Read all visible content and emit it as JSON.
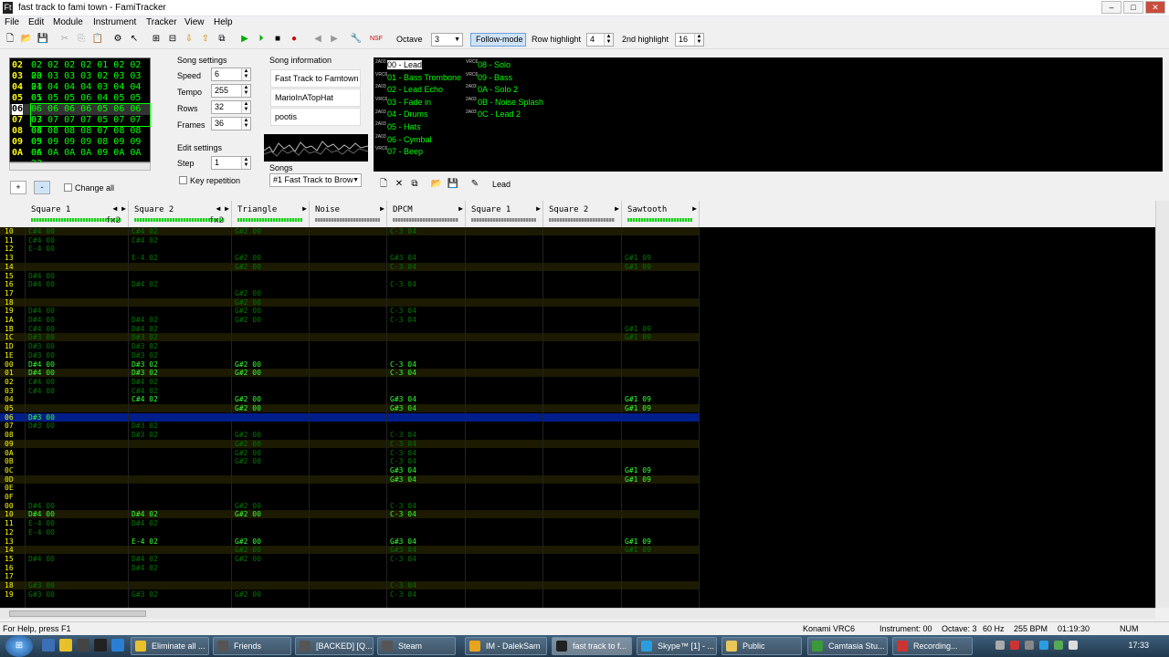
{
  "window": {
    "title": "fast track to fami town - FamiTracker",
    "icon": "Ft"
  },
  "menu": [
    "File",
    "Edit",
    "Module",
    "Instrument",
    "Tracker",
    "View",
    "Help"
  ],
  "toolbar": {
    "octave_label": "Octave",
    "octave_value": "3",
    "follow_mode": "Follow-mode",
    "row_highlight_label": "Row highlight",
    "row_highlight_value": "4",
    "second_highlight_label": "2nd highlight",
    "second_highlight_value": "16",
    "nsf": "NSF"
  },
  "frames": {
    "rows": [
      {
        "n": "02",
        "c": "02 02 02 02 01 02 02 20"
      },
      {
        "n": "03",
        "c": "03 03 03 03 02 03 03 21"
      },
      {
        "n": "04",
        "c": "04 04 04 04 03 04 04 01"
      },
      {
        "n": "05",
        "c": "05 05 05 06 04 05 05 02"
      },
      {
        "n": "06",
        "c": "06 06 06 06 05 06 06 03",
        "current": true
      },
      {
        "n": "07",
        "c": "07 07 07 07 05 07 07 04"
      },
      {
        "n": "08",
        "c": "08 08 08 08 07 08 08 05"
      },
      {
        "n": "09",
        "c": "09 09 09 09 08 09 09 06"
      },
      {
        "n": "0A",
        "c": "0A 0A 0A 0A 09 0A 0A 22"
      }
    ]
  },
  "song_settings": {
    "title": "Song settings",
    "speed_label": "Speed",
    "speed": "6",
    "tempo_label": "Tempo",
    "tempo": "255",
    "rows_label": "Rows",
    "rows": "32",
    "frames_label": "Frames",
    "frames": "36"
  },
  "edit_settings": {
    "title": "Edit settings",
    "step_label": "Step",
    "step": "1",
    "key_repetition": "Key repetition"
  },
  "song_info": {
    "title": "Song information",
    "name": "Fast Track to Famtown",
    "artist": "MarioInATopHat",
    "copyright": "pootis"
  },
  "songs": {
    "label": "Songs",
    "selected": "#1 Fast Track to Brow"
  },
  "frame_buttons": {
    "add": "+",
    "remove": "-",
    "change_all": "Change all"
  },
  "instruments": [
    {
      "id": "00 - Lead",
      "tag": "2A03",
      "selected": true
    },
    {
      "id": "01 - Bass Trombone",
      "tag": "VRC6"
    },
    {
      "id": "02 - Lead Echo",
      "tag": "2A03"
    },
    {
      "id": "03 - Fade in",
      "tag": "VRC6"
    },
    {
      "id": "04 - Drums",
      "tag": "2A03"
    },
    {
      "id": "05 - Hats",
      "tag": "2A03"
    },
    {
      "id": "06 - Cymbal",
      "tag": "2A03"
    },
    {
      "id": "07 - Beep",
      "tag": "VRC6"
    },
    {
      "id": "08 - Solo",
      "tag": "VRC6"
    },
    {
      "id": "09 - Bass",
      "tag": "VRC6"
    },
    {
      "id": "0A - Solo 2",
      "tag": "2A03"
    },
    {
      "id": "0B - Noise Splash",
      "tag": "2A03"
    },
    {
      "id": "0C - Lead 2",
      "tag": "2A03"
    }
  ],
  "instrument_name": "Lead",
  "channels": [
    {
      "name": "Square 1",
      "fx": "fx2",
      "on": true
    },
    {
      "name": "Square 2",
      "fx": "fx2",
      "on": true
    },
    {
      "name": "Triangle",
      "fx": "",
      "on": true
    },
    {
      "name": "Noise",
      "fx": "",
      "on": false
    },
    {
      "name": "DPCM",
      "fx": "",
      "on": false
    },
    {
      "name": "Square 1",
      "fx": "",
      "on": false
    },
    {
      "name": "Square 2",
      "fx": "",
      "on": false
    },
    {
      "name": "Sawtooth",
      "fx": "",
      "on": true
    }
  ],
  "pattern_rows": [
    {
      "n": "10",
      "c": [
        "C#4 00",
        "C#4 02",
        "G#2 00",
        "",
        "C-3 04",
        "",
        "",
        ""
      ]
    },
    {
      "n": "11",
      "c": [
        "C#4 00",
        "C#4 02",
        "",
        "",
        "",
        "",
        "",
        ""
      ]
    },
    {
      "n": "12",
      "c": [
        "E-4 00",
        "",
        "",
        "",
        "",
        "",
        "",
        ""
      ]
    },
    {
      "n": "13",
      "c": [
        "",
        "E-4 02",
        "G#2 00",
        "",
        "G#3 04",
        "",
        "",
        "G#1 09"
      ]
    },
    {
      "n": "14",
      "c": [
        "",
        "",
        "G#2 00",
        "",
        "C-3 04",
        "",
        "",
        "G#1 09"
      ]
    },
    {
      "n": "15",
      "c": [
        "D#4 00",
        "",
        "",
        "",
        "",
        "",
        "",
        ""
      ]
    },
    {
      "n": "16",
      "c": [
        "D#4 00",
        "D#4 02",
        "",
        "",
        "C-3 04",
        "",
        "",
        ""
      ]
    },
    {
      "n": "17",
      "c": [
        "",
        "",
        "G#2 00",
        "",
        "",
        "",
        "",
        ""
      ]
    },
    {
      "n": "18",
      "c": [
        "",
        "",
        "G#2 00",
        "",
        "",
        "",
        "",
        ""
      ]
    },
    {
      "n": "19",
      "c": [
        "D#4 00",
        "",
        "G#2 00",
        "",
        "C-3 04",
        "",
        "",
        ""
      ]
    },
    {
      "n": "1A",
      "c": [
        "D#4 00",
        "D#4 02",
        "G#2 00",
        "",
        "C-3 04",
        "",
        "",
        ""
      ]
    },
    {
      "n": "1B",
      "c": [
        "C#4 00",
        "D#4 02",
        "",
        "",
        "",
        "",
        "",
        "G#1 09"
      ]
    },
    {
      "n": "1C",
      "c": [
        "D#3 00",
        "D#3 02",
        "",
        "",
        "",
        "",
        "",
        "G#1 09"
      ]
    },
    {
      "n": "1D",
      "c": [
        "D#3 00",
        "D#3 02",
        "",
        "",
        "",
        "",
        "",
        ""
      ]
    },
    {
      "n": "1E",
      "c": [
        "D#3 00",
        "D#3 02",
        "",
        "",
        "",
        "",
        "",
        ""
      ]
    },
    {
      "n": "00",
      "c": [
        "D#4 00",
        "D#3 02",
        "G#2 00",
        "",
        "C-3 04",
        "",
        "",
        ""
      ],
      "b": true
    },
    {
      "n": "01",
      "c": [
        "D#4 00",
        "D#3 02",
        "G#2 00",
        "",
        "C-3 04",
        "",
        "",
        ""
      ],
      "b": true
    },
    {
      "n": "02",
      "c": [
        "C#4 00",
        "D#4 02",
        "",
        "",
        "",
        "",
        "",
        ""
      ]
    },
    {
      "n": "03",
      "c": [
        "C#4 00",
        "C#4 02",
        "",
        "",
        "",
        "",
        "",
        ""
      ]
    },
    {
      "n": "04",
      "c": [
        "",
        "C#4 02",
        "G#2 00",
        "",
        "G#3 04",
        "",
        "",
        "G#1 09"
      ],
      "b": true
    },
    {
      "n": "05",
      "c": [
        "",
        "",
        "G#2 00",
        "",
        "G#3 04",
        "",
        "",
        "G#1 09"
      ],
      "b": true
    },
    {
      "n": "06",
      "c": [
        "D#3 00",
        "",
        "",
        "",
        "",
        "",
        "",
        ""
      ],
      "cur": true
    },
    {
      "n": "07",
      "c": [
        "D#3 00",
        "D#3 02",
        "",
        "",
        "",
        "",
        "",
        ""
      ]
    },
    {
      "n": "08",
      "c": [
        "",
        "D#3 02",
        "G#2 00",
        "",
        "C-3 04",
        "",
        "",
        ""
      ]
    },
    {
      "n": "09",
      "c": [
        "",
        "",
        "G#2 00",
        "",
        "C-3 04",
        "",
        "",
        ""
      ]
    },
    {
      "n": "0A",
      "c": [
        "",
        "",
        "G#2 00",
        "",
        "C-3 04",
        "",
        "",
        ""
      ]
    },
    {
      "n": "0B",
      "c": [
        "",
        "",
        "G#2 00",
        "",
        "C-3 04",
        "",
        "",
        ""
      ]
    },
    {
      "n": "0C",
      "c": [
        "",
        "",
        "",
        "",
        "G#3 04",
        "",
        "",
        "G#1 09"
      ],
      "b": true
    },
    {
      "n": "0D",
      "c": [
        "",
        "",
        "",
        "",
        "G#3 04",
        "",
        "",
        "G#1 09"
      ],
      "b": true
    },
    {
      "n": "0E",
      "c": [
        "",
        "",
        "",
        "",
        "",
        "",
        "",
        ""
      ]
    },
    {
      "n": "0F",
      "c": [
        "",
        "",
        "",
        "",
        "",
        "",
        "",
        ""
      ]
    },
    {
      "n": "00",
      "c": [
        "D#4 00",
        "",
        "G#2 00",
        "",
        "C-3 04",
        "",
        "",
        ""
      ]
    },
    {
      "n": "10",
      "c": [
        "D#4 00",
        "D#4 02",
        "G#2 00",
        "",
        "C-3 04",
        "",
        "",
        ""
      ],
      "b": true
    },
    {
      "n": "11",
      "c": [
        "E-4 00",
        "D#4 02",
        "",
        "",
        "",
        "",
        "",
        ""
      ]
    },
    {
      "n": "12",
      "c": [
        "E-4 00",
        "",
        "",
        "",
        "",
        "",
        "",
        ""
      ]
    },
    {
      "n": "13",
      "c": [
        "",
        "E-4 02",
        "G#2 00",
        "",
        "G#3 04",
        "",
        "",
        "G#1 09"
      ],
      "b": true
    },
    {
      "n": "14",
      "c": [
        "",
        "",
        "G#2 00",
        "",
        "G#3 04",
        "",
        "",
        "G#1 09"
      ]
    },
    {
      "n": "15",
      "c": [
        "D#4 00",
        "D#4 02",
        "G#2 00",
        "",
        "C-3 04",
        "",
        "",
        ""
      ]
    },
    {
      "n": "16",
      "c": [
        "",
        "D#4 02",
        "",
        "",
        "",
        "",
        "",
        ""
      ]
    },
    {
      "n": "17",
      "c": [
        "",
        "",
        "",
        "",
        "",
        "",
        "",
        ""
      ]
    },
    {
      "n": "18",
      "c": [
        "G#3 00",
        "",
        "",
        "",
        "C-3 04",
        "",
        "",
        ""
      ]
    },
    {
      "n": "19",
      "c": [
        "G#3 00",
        "G#3 02",
        "G#2 00",
        "",
        "C-3 04",
        "",
        "",
        ""
      ]
    }
  ],
  "statusbar": {
    "help": "For Help, press F1",
    "chip": "Konami VRC6",
    "instrument": "Instrument: 00",
    "octave": "Octave: 3",
    "rate": "60 Hz",
    "bpm": "255 BPM",
    "time": "01:19:30",
    "num": "NUM"
  },
  "taskbar": {
    "items": [
      "Eliminate all ...",
      "Friends",
      "[BACKED] [Q...",
      "Steam",
      "IM - DalekSam",
      "fast track to f...",
      "Skype™ [1] - ...",
      "Public",
      "Camtasia Stu...",
      "Recording..."
    ],
    "clock": "17:33"
  }
}
